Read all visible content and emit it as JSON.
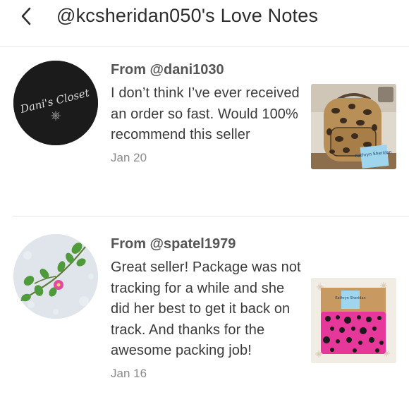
{
  "header": {
    "title": "@kcsheridan050's Love Notes",
    "back_icon": "chevron-left-icon"
  },
  "notes": [
    {
      "from": "From @dani1030",
      "message": "I don’t think I’ve ever received an order so fast. Would 100% recommend this seller",
      "date": "Jan 20",
      "avatar_text": "Dani's Closet",
      "thumb_note": "Kathryn Sheridan"
    },
    {
      "from": "From @spatel1979",
      "message": "Great seller! Package was not tracking for a while and she did her best to get it back on track. And thanks for the awesome packing job!",
      "date": "Jan 16",
      "thumb_note": "Kathryn Sheridan"
    }
  ],
  "colors": {
    "text_primary": "#3a3a3a",
    "text_secondary": "#8a8a8a",
    "divider": "#e6e6e6"
  }
}
